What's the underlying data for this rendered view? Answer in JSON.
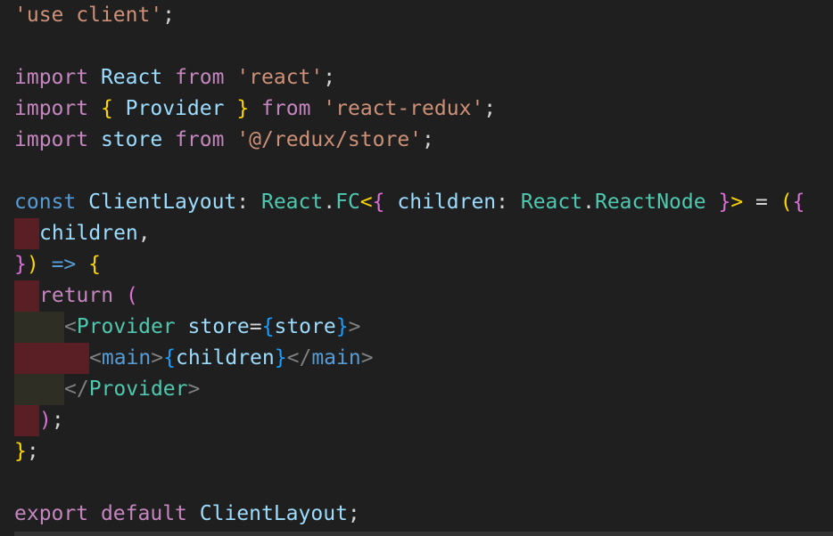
{
  "editor": {
    "language": "typescriptreact",
    "colors": {
      "background": "#1f1f1f",
      "string": "#ce9178",
      "keyword_control": "#c586c0",
      "keyword": "#569cd6",
      "variable": "#9cdcfe",
      "type": "#4ec9b0",
      "function": "#dcdcaa",
      "bracket_gold": "#ffd700",
      "bracket_purple": "#da70d6",
      "bracket_blue": "#179fff",
      "punctuation": "#d4d4d4",
      "tag_bracket": "#808080",
      "indent_error": "#5a1f24",
      "indent_ok": "#2e2e24"
    },
    "lines": [
      {
        "indent": [],
        "tokens": [
          {
            "t": "'use client'",
            "c": "string"
          },
          {
            "t": ";",
            "c": "punctuation"
          }
        ]
      },
      {
        "indent": [],
        "tokens": []
      },
      {
        "indent": [],
        "tokens": [
          {
            "t": "import",
            "c": "keyword_control"
          },
          {
            "t": " ",
            "c": "punctuation"
          },
          {
            "t": "React",
            "c": "variable"
          },
          {
            "t": " ",
            "c": "punctuation"
          },
          {
            "t": "from",
            "c": "keyword_control"
          },
          {
            "t": " ",
            "c": "punctuation"
          },
          {
            "t": "'react'",
            "c": "string"
          },
          {
            "t": ";",
            "c": "punctuation"
          }
        ]
      },
      {
        "indent": [],
        "tokens": [
          {
            "t": "import",
            "c": "keyword_control"
          },
          {
            "t": " ",
            "c": "punctuation"
          },
          {
            "t": "{",
            "c": "bracket_gold"
          },
          {
            "t": " ",
            "c": "punctuation"
          },
          {
            "t": "Provider",
            "c": "variable"
          },
          {
            "t": " ",
            "c": "punctuation"
          },
          {
            "t": "}",
            "c": "bracket_gold"
          },
          {
            "t": " ",
            "c": "punctuation"
          },
          {
            "t": "from",
            "c": "keyword_control"
          },
          {
            "t": " ",
            "c": "punctuation"
          },
          {
            "t": "'react-redux'",
            "c": "string"
          },
          {
            "t": ";",
            "c": "punctuation"
          }
        ]
      },
      {
        "indent": [],
        "tokens": [
          {
            "t": "import",
            "c": "keyword_control"
          },
          {
            "t": " ",
            "c": "punctuation"
          },
          {
            "t": "store",
            "c": "variable"
          },
          {
            "t": " ",
            "c": "punctuation"
          },
          {
            "t": "from",
            "c": "keyword_control"
          },
          {
            "t": " ",
            "c": "punctuation"
          },
          {
            "t": "'@/redux/store'",
            "c": "string"
          },
          {
            "t": ";",
            "c": "punctuation"
          }
        ]
      },
      {
        "indent": [],
        "tokens": []
      },
      {
        "indent": [],
        "tokens": [
          {
            "t": "const",
            "c": "keyword"
          },
          {
            "t": " ",
            "c": "punctuation"
          },
          {
            "t": "ClientLayout",
            "c": "variable"
          },
          {
            "t": ": ",
            "c": "punctuation"
          },
          {
            "t": "React",
            "c": "type"
          },
          {
            "t": ".",
            "c": "punctuation"
          },
          {
            "t": "FC",
            "c": "type"
          },
          {
            "t": "<",
            "c": "bracket_gold"
          },
          {
            "t": "{",
            "c": "bracket_purple"
          },
          {
            "t": " ",
            "c": "punctuation"
          },
          {
            "t": "children",
            "c": "variable"
          },
          {
            "t": ": ",
            "c": "punctuation"
          },
          {
            "t": "React",
            "c": "type"
          },
          {
            "t": ".",
            "c": "punctuation"
          },
          {
            "t": "ReactNode",
            "c": "type"
          },
          {
            "t": " ",
            "c": "punctuation"
          },
          {
            "t": "}",
            "c": "bracket_purple"
          },
          {
            "t": ">",
            "c": "bracket_gold"
          },
          {
            "t": " = ",
            "c": "punctuation"
          },
          {
            "t": "(",
            "c": "bracket_gold"
          },
          {
            "t": "{",
            "c": "bracket_purple"
          }
        ]
      },
      {
        "indent": [
          "red"
        ],
        "tokens": [
          {
            "t": "children",
            "c": "variable"
          },
          {
            "t": ",",
            "c": "punctuation"
          }
        ]
      },
      {
        "indent": [],
        "tokens": [
          {
            "t": "}",
            "c": "bracket_purple"
          },
          {
            "t": ")",
            "c": "bracket_gold"
          },
          {
            "t": " ",
            "c": "punctuation"
          },
          {
            "t": "=>",
            "c": "keyword"
          },
          {
            "t": " ",
            "c": "punctuation"
          },
          {
            "t": "{",
            "c": "bracket_gold"
          }
        ]
      },
      {
        "indent": [
          "red"
        ],
        "tokens": [
          {
            "t": "return",
            "c": "keyword_control"
          },
          {
            "t": " ",
            "c": "punctuation"
          },
          {
            "t": "(",
            "c": "bracket_purple"
          }
        ]
      },
      {
        "indent": [
          "olive",
          "olive"
        ],
        "tokens": [
          {
            "t": "<",
            "c": "tag_bracket"
          },
          {
            "t": "Provider",
            "c": "type"
          },
          {
            "t": " ",
            "c": "punctuation"
          },
          {
            "t": "store",
            "c": "variable"
          },
          {
            "t": "=",
            "c": "punctuation"
          },
          {
            "t": "{",
            "c": "bracket_blue"
          },
          {
            "t": "store",
            "c": "variable"
          },
          {
            "t": "}",
            "c": "bracket_blue"
          },
          {
            "t": ">",
            "c": "tag_bracket"
          }
        ]
      },
      {
        "indent": [
          "red",
          "red",
          "red"
        ],
        "tokens": [
          {
            "t": "<",
            "c": "tag_bracket"
          },
          {
            "t": "main",
            "c": "keyword"
          },
          {
            "t": ">",
            "c": "tag_bracket"
          },
          {
            "t": "{",
            "c": "bracket_blue"
          },
          {
            "t": "children",
            "c": "variable"
          },
          {
            "t": "}",
            "c": "bracket_blue"
          },
          {
            "t": "</",
            "c": "tag_bracket"
          },
          {
            "t": "main",
            "c": "keyword"
          },
          {
            "t": ">",
            "c": "tag_bracket"
          }
        ]
      },
      {
        "indent": [
          "olive",
          "olive"
        ],
        "tokens": [
          {
            "t": "</",
            "c": "tag_bracket"
          },
          {
            "t": "Provider",
            "c": "type"
          },
          {
            "t": ">",
            "c": "tag_bracket"
          }
        ]
      },
      {
        "indent": [
          "red"
        ],
        "tokens": [
          {
            "t": ")",
            "c": "bracket_purple"
          },
          {
            "t": ";",
            "c": "punctuation"
          }
        ]
      },
      {
        "indent": [],
        "tokens": [
          {
            "t": "}",
            "c": "bracket_gold"
          },
          {
            "t": ";",
            "c": "punctuation"
          }
        ]
      },
      {
        "indent": [],
        "tokens": []
      },
      {
        "indent": [],
        "tokens": [
          {
            "t": "export",
            "c": "keyword_control"
          },
          {
            "t": " ",
            "c": "punctuation"
          },
          {
            "t": "default",
            "c": "keyword_control"
          },
          {
            "t": " ",
            "c": "punctuation"
          },
          {
            "t": "ClientLayout",
            "c": "variable"
          },
          {
            "t": ";",
            "c": "punctuation"
          }
        ]
      }
    ]
  }
}
